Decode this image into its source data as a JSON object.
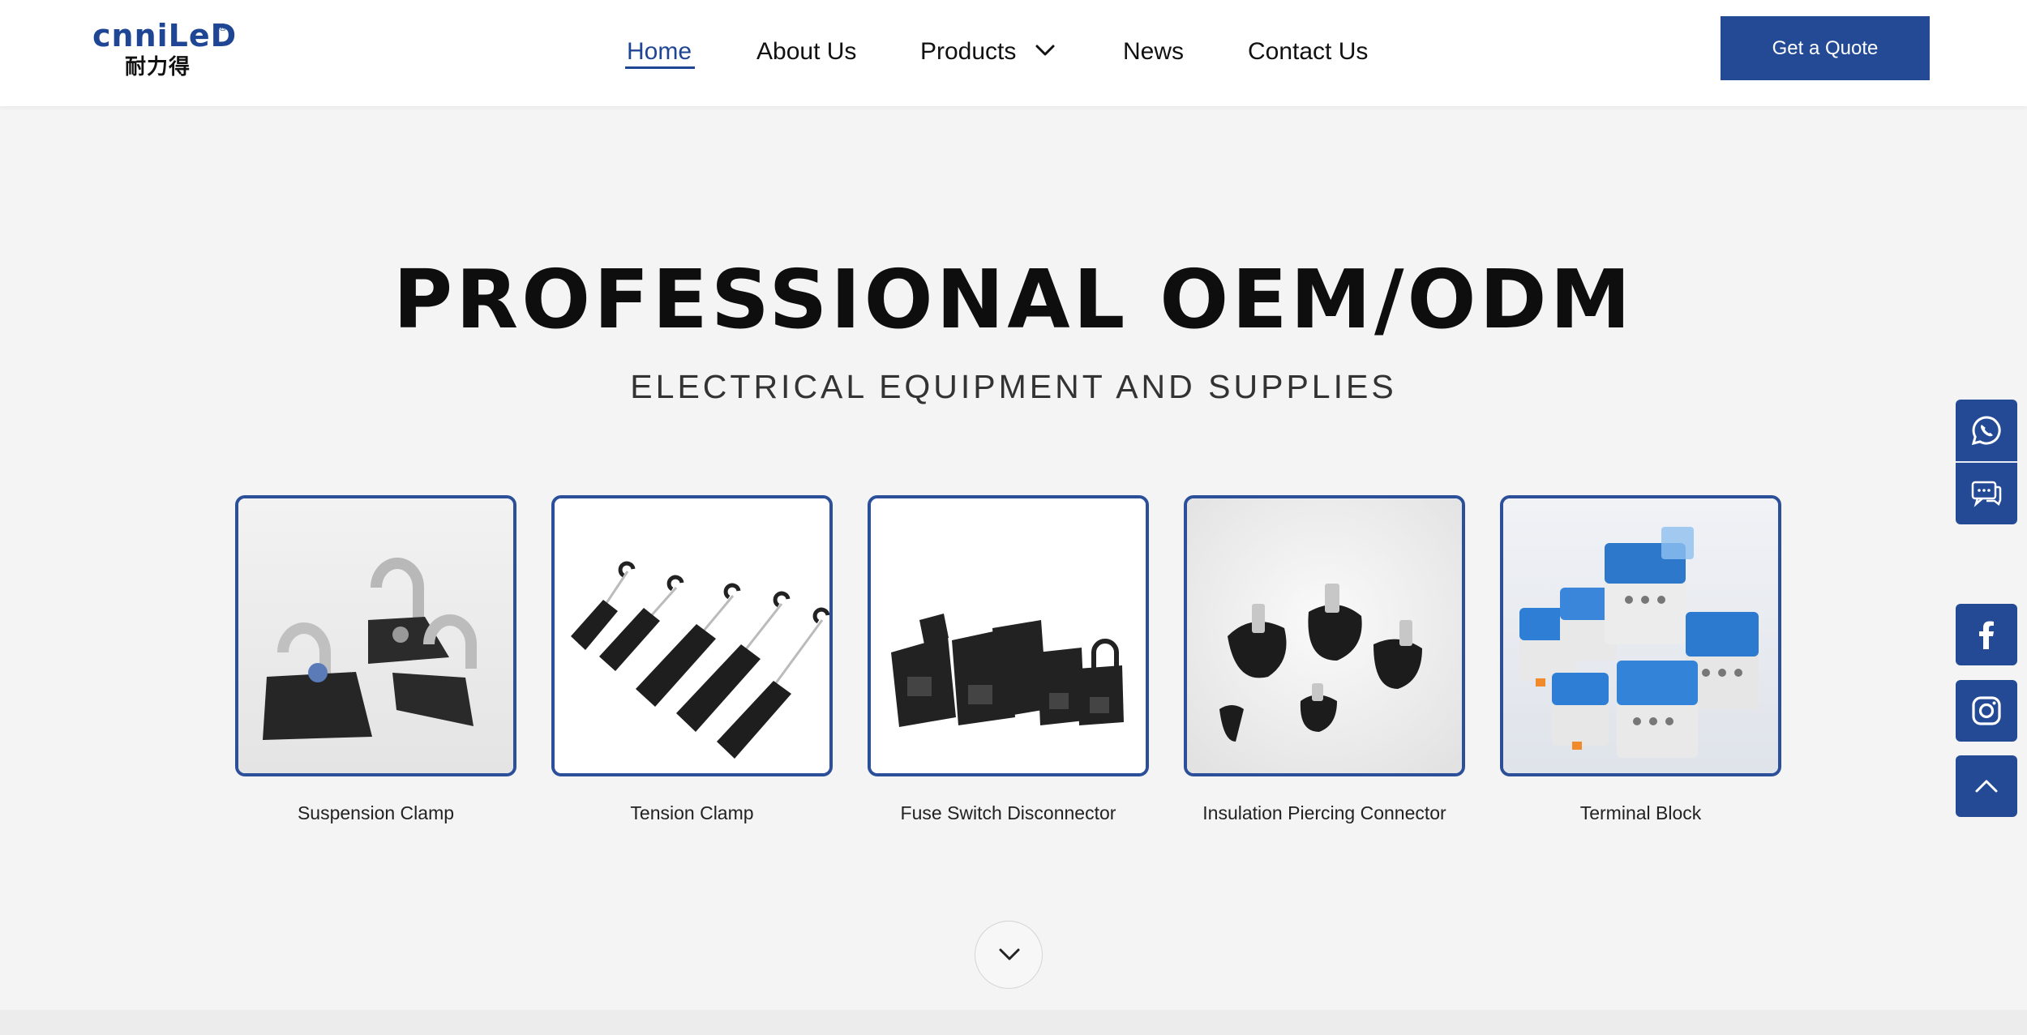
{
  "header": {
    "logo": {
      "latin": "cnniLeD",
      "reg": "®",
      "chinese": "耐力得"
    },
    "nav": [
      {
        "label": "Home",
        "active": true
      },
      {
        "label": "About Us"
      },
      {
        "label": "Products",
        "has_dropdown": true
      },
      {
        "label": "News"
      },
      {
        "label": "Contact Us"
      }
    ],
    "quote_label": "Get a Quote"
  },
  "hero": {
    "title": "PROFESSIONAL OEM/ODM",
    "subtitle": "ELECTRICAL EQUIPMENT AND SUPPLIES"
  },
  "products": [
    {
      "label": "Suspension Clamp",
      "icon": "suspension-clamp-image"
    },
    {
      "label": "Tension Clamp",
      "icon": "tension-clamp-image"
    },
    {
      "label": "Fuse Switch Disconnector",
      "icon": "fuse-switch-disconnector-image"
    },
    {
      "label": "Insulation Piercing Connector",
      "icon": "insulation-piercing-connector-image"
    },
    {
      "label": "Terminal Block",
      "icon": "terminal-block-image"
    }
  ],
  "side_buttons": [
    "whatsapp-icon",
    "chat-icon",
    "facebook-icon",
    "instagram-icon",
    "back-to-top-icon"
  ],
  "colors": {
    "brand": "#244a96",
    "card_border": "#2c4f99",
    "background": "#f4f4f4"
  }
}
